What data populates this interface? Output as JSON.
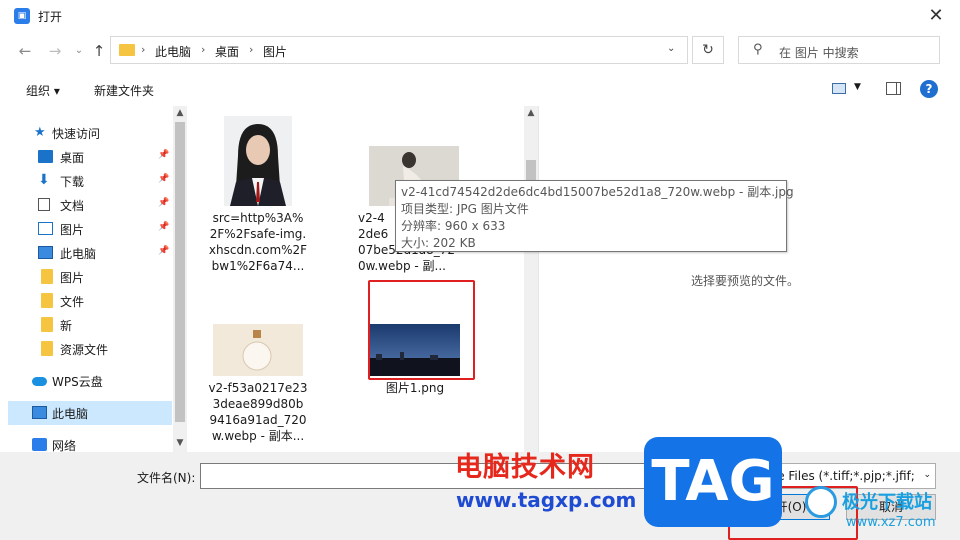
{
  "titlebar": {
    "title": "打开",
    "close_icon": "✕"
  },
  "nav": {
    "breadcrumb": [
      "此电脑",
      "桌面",
      "图片"
    ],
    "search_placeholder": "在 图片 中搜索"
  },
  "toolbar": {
    "organize": "组织 ▾",
    "new_folder": "新建文件夹",
    "help": "?"
  },
  "sidebar": {
    "items": [
      {
        "label": "快速访问",
        "icon": "star-icon",
        "pinned": false
      },
      {
        "label": "桌面",
        "icon": "desktop-icon",
        "pinned": true
      },
      {
        "label": "下载",
        "icon": "download-icon",
        "pinned": true
      },
      {
        "label": "文档",
        "icon": "document-icon",
        "pinned": true
      },
      {
        "label": "图片",
        "icon": "pictures-icon",
        "pinned": true
      },
      {
        "label": "此电脑",
        "icon": "computer-icon",
        "pinned": true
      },
      {
        "label": "图片",
        "icon": "folder-icon",
        "pinned": false
      },
      {
        "label": "文件",
        "icon": "folder-icon",
        "pinned": false
      },
      {
        "label": "新",
        "icon": "folder-icon",
        "pinned": false
      },
      {
        "label": "资源文件",
        "icon": "folder-icon",
        "pinned": false
      },
      {
        "label": "WPS云盘",
        "icon": "cloud-icon",
        "pinned": false
      },
      {
        "label": "此电脑",
        "icon": "computer-icon",
        "pinned": false,
        "selected": true
      },
      {
        "label": "网络",
        "icon": "network-icon",
        "pinned": false
      }
    ]
  },
  "files": [
    {
      "name": "src=http%3A%2F%2Fsafe-img.xhscdn.com%2Fbw1%2F6a74..."
    },
    {
      "name": "v2-4...2de6...07be52d1a8_720w.webp - 副..."
    },
    {
      "name": "v2-f53a0217e233deae899d80b9416a91ad_720w.webp - 副本..."
    },
    {
      "name": "图片1.png"
    }
  ],
  "files_display": {
    "f0": [
      "src=http%3A%",
      "2F%2Fsafe-img.",
      "xhscdn.com%2F",
      "bw1%2F6a74..."
    ],
    "f1": [
      "v2-4",
      "2de6",
      "07be52d1a8_72",
      "0w.webp - 副..."
    ],
    "f2": [
      "v2-f53a0217e23",
      "3deae899d80b",
      "9416a91ad_720",
      "w.webp - 副本..."
    ],
    "f3": [
      "图片1.png"
    ]
  },
  "tooltip": {
    "name": "v2-41cd74542d2de6dc4bd15007be52d1a8_720w.webp - 副本.jpg",
    "type": "项目类型: JPG 图片文件",
    "resolution": "分辨率: 960 x 633",
    "size": "大小: 202 KB"
  },
  "preview": {
    "message": "选择要预览的文件。"
  },
  "bottom": {
    "filename_label": "文件名(N):",
    "filename_value": "",
    "filter": "Image Files (*.tiff;*.pjp;*.jfif;*.",
    "open_button": "打开(O)",
    "cancel_button": "取消"
  },
  "watermark": {
    "title": "电脑技术网",
    "url": "www.tagxp.com",
    "tag": "TAG",
    "site": "极光下载站",
    "site_url": "www.xz7.com"
  },
  "colors": {
    "accent": "#0078d7",
    "highlight_box": "#e02020",
    "selection": "#cce8ff"
  }
}
